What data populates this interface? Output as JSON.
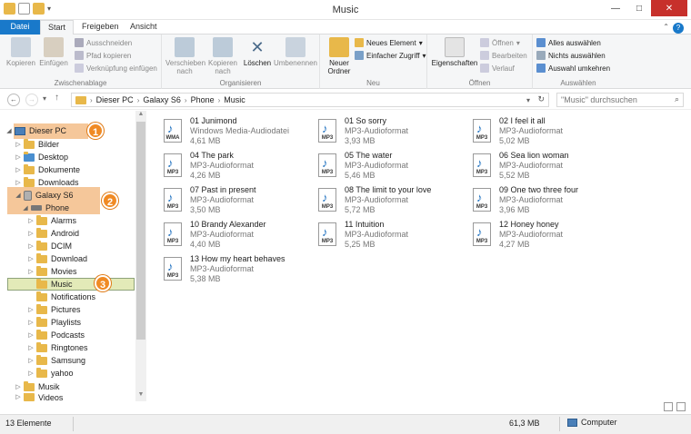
{
  "window": {
    "title": "Music"
  },
  "tabs": {
    "file": "Datei",
    "start": "Start",
    "share": "Freigeben",
    "view": "Ansicht"
  },
  "ribbon": {
    "clipboard": {
      "label": "Zwischenablage",
      "copy": "Kopieren",
      "paste": "Einfügen",
      "cut": "Ausschneiden",
      "copy_path": "Pfad kopieren",
      "paste_shortcut": "Verknüpfung einfügen"
    },
    "organize": {
      "label": "Organisieren",
      "move_to_1": "Verschieben",
      "move_to_2": "nach",
      "copy_to_1": "Kopieren",
      "copy_to_2": "nach",
      "delete": "Löschen",
      "rename": "Umbenennen"
    },
    "new": {
      "label": "Neu",
      "new_folder_1": "Neuer",
      "new_folder_2": "Ordner",
      "new_item": "Neues Element",
      "easy_access": "Einfacher Zugriff"
    },
    "open": {
      "label": "Öffnen",
      "properties": "Eigenschaften",
      "open": "Öffnen",
      "edit": "Bearbeiten",
      "history": "Verlauf"
    },
    "select": {
      "label": "Auswählen",
      "select_all": "Alles auswählen",
      "select_none": "Nichts auswählen",
      "invert": "Auswahl umkehren"
    }
  },
  "address": {
    "crumbs": [
      "Dieser PC",
      "Galaxy S6",
      "Phone",
      "Music"
    ],
    "search_placeholder": "\"Music\" durchsuchen"
  },
  "tree": {
    "this_pc": "Dieser PC",
    "bilder": "Bilder",
    "desktop": "Desktop",
    "dokumente": "Dokumente",
    "downloads": "Downloads",
    "galaxy": "Galaxy S6",
    "phone": "Phone",
    "alarms": "Alarms",
    "android": "Android",
    "dcim": "DCIM",
    "download": "Download",
    "movies": "Movies",
    "music": "Music",
    "notifications": "Notifications",
    "pictures": "Pictures",
    "playlists": "Playlists",
    "podcasts": "Podcasts",
    "ringtones": "Ringtones",
    "samsung": "Samsung",
    "yahoo": "yahoo",
    "musik": "Musik",
    "videos": "Videos"
  },
  "badges": {
    "b1": "1",
    "b2": "2",
    "b3": "3"
  },
  "files": [
    {
      "name": "01 Junimond",
      "type": "Windows Media-Audiodatei",
      "size": "4,61 MB",
      "ext": "WMA"
    },
    {
      "name": "01 So sorry",
      "type": "MP3-Audioformat",
      "size": "3,93 MB",
      "ext": "MP3"
    },
    {
      "name": "02 I feel it all",
      "type": "MP3-Audioformat",
      "size": "5,02 MB",
      "ext": "MP3"
    },
    {
      "name": "04 The park",
      "type": "MP3-Audioformat",
      "size": "4,26 MB",
      "ext": "MP3"
    },
    {
      "name": "05 The water",
      "type": "MP3-Audioformat",
      "size": "5,46 MB",
      "ext": "MP3"
    },
    {
      "name": "06 Sea lion woman",
      "type": "MP3-Audioformat",
      "size": "5,52 MB",
      "ext": "MP3"
    },
    {
      "name": "07 Past in present",
      "type": "MP3-Audioformat",
      "size": "3,50 MB",
      "ext": "MP3"
    },
    {
      "name": "08 The limit to your love",
      "type": "MP3-Audioformat",
      "size": "5,72 MB",
      "ext": "MP3"
    },
    {
      "name": "09 One two three four",
      "type": "MP3-Audioformat",
      "size": "3,96 MB",
      "ext": "MP3"
    },
    {
      "name": "10 Brandy Alexander",
      "type": "MP3-Audioformat",
      "size": "4,40 MB",
      "ext": "MP3"
    },
    {
      "name": "11 Intuition",
      "type": "MP3-Audioformat",
      "size": "5,25 MB",
      "ext": "MP3"
    },
    {
      "name": "12 Honey honey",
      "type": "MP3-Audioformat",
      "size": "4,27 MB",
      "ext": "MP3"
    },
    {
      "name": "13 How my heart behaves",
      "type": "MP3-Audioformat",
      "size": "5,38 MB",
      "ext": "MP3"
    }
  ],
  "status": {
    "count": "13 Elemente",
    "total_size": "61,3 MB",
    "location": "Computer"
  }
}
